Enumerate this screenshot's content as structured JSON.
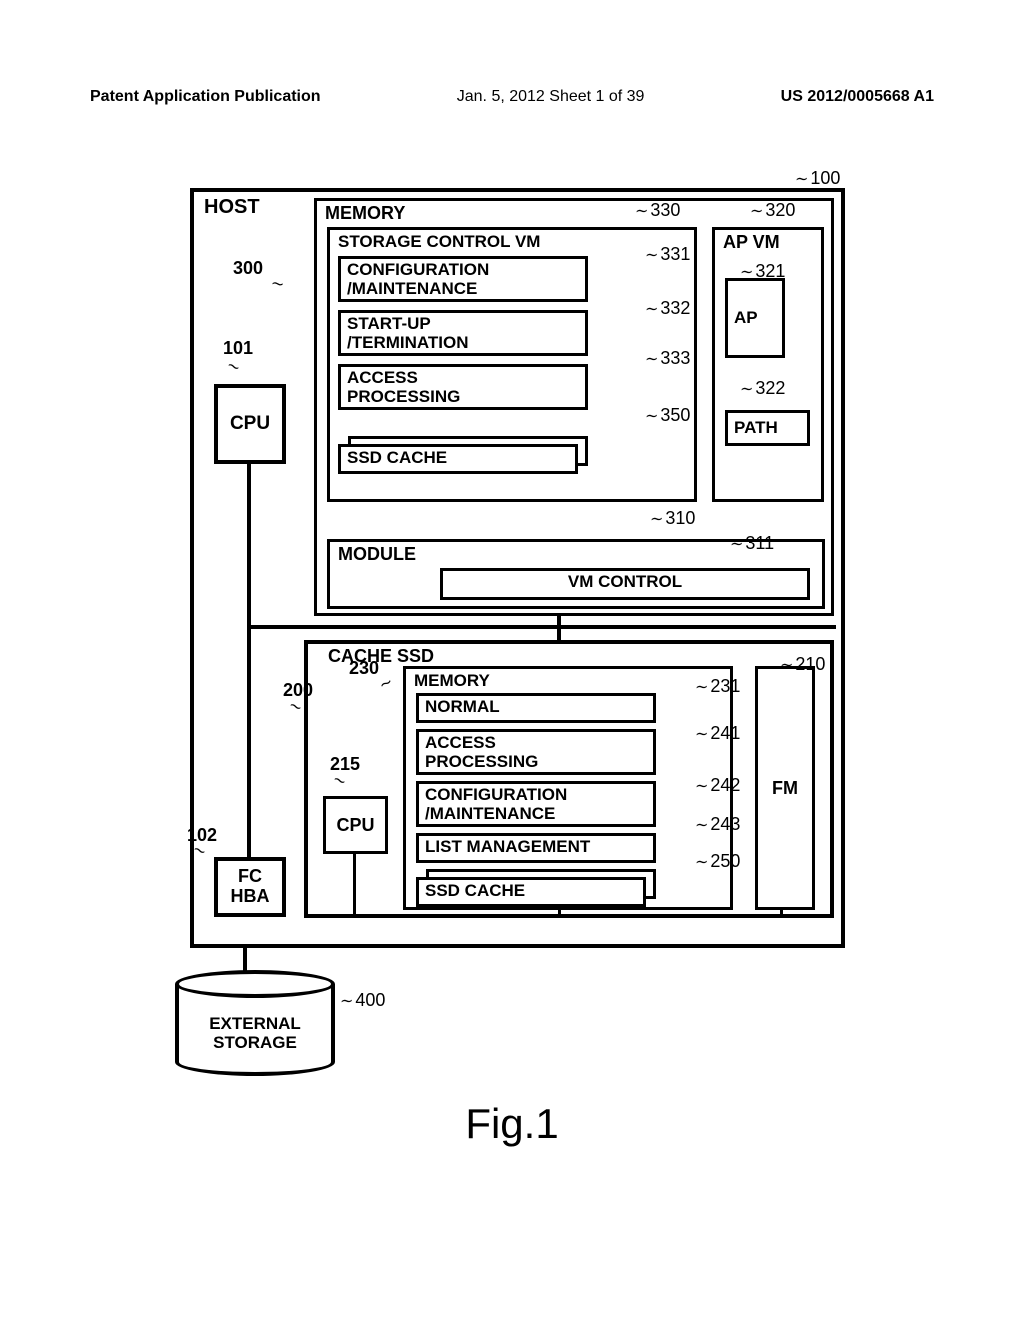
{
  "header": {
    "left": "Patent Application Publication",
    "middle": "Jan. 5, 2012  Sheet 1 of 39",
    "right": "US 2012/0005668 A1"
  },
  "figure_label": "Fig.1",
  "refs": {
    "r100": "100",
    "r101": "101",
    "r102": "102",
    "r200": "200",
    "r210": "210",
    "r215": "215",
    "r230": "230",
    "r231": "231",
    "r241": "241",
    "r242": "242",
    "r243": "243",
    "r250": "250",
    "r300": "300",
    "r310": "310",
    "r311": "311",
    "r320": "320",
    "r321": "321",
    "r322": "322",
    "r330": "330",
    "r331": "331",
    "r332": "332",
    "r333": "333",
    "r350": "350",
    "r400": "400"
  },
  "labels": {
    "host": "HOST",
    "memory": "MEMORY",
    "storage_control_vm": "STORAGE CONTROL VM",
    "config_maint": "CONFIGURATION\n/MAINTENANCE",
    "startup_term": "START-UP\n/TERMINATION",
    "access_proc": "ACCESS\nPROCESSING",
    "ssd_cache": "SSD CACHE",
    "ap_vm": "AP VM",
    "ap": "AP",
    "path": "PATH",
    "module": "MODULE",
    "vm_control": "VM CONTROL",
    "cpu": "CPU",
    "cache_ssd": "CACHE SSD",
    "normal": "NORMAL",
    "list_mgmt": "LIST MANAGEMENT",
    "fm": "FM",
    "fc": "FC",
    "hba": "HBA",
    "external": "EXTERNAL",
    "storage": "STORAGE"
  },
  "chart_data": {
    "type": "diagram",
    "title": "Fig.1",
    "components": [
      {
        "id": 100,
        "name": "HOST",
        "contains": [
          101,
          102,
          300,
          200
        ]
      },
      {
        "id": 101,
        "name": "CPU"
      },
      {
        "id": 102,
        "name": "FC HBA"
      },
      {
        "id": 300,
        "name": "MEMORY",
        "contains": [
          330,
          320,
          310
        ]
      },
      {
        "id": 330,
        "name": "STORAGE CONTROL VM",
        "contains": [
          331,
          332,
          333,
          350
        ]
      },
      {
        "id": 331,
        "name": "CONFIGURATION/MAINTENANCE"
      },
      {
        "id": 332,
        "name": "START-UP/TERMINATION"
      },
      {
        "id": 333,
        "name": "ACCESS PROCESSING"
      },
      {
        "id": 350,
        "name": "SSD CACHE"
      },
      {
        "id": 320,
        "name": "AP VM",
        "contains": [
          321,
          322
        ]
      },
      {
        "id": 321,
        "name": "AP"
      },
      {
        "id": 322,
        "name": "PATH"
      },
      {
        "id": 310,
        "name": "MODULE",
        "contains": [
          311
        ]
      },
      {
        "id": 311,
        "name": "VM CONTROL"
      },
      {
        "id": 200,
        "name": "CACHE SSD",
        "contains": [
          215,
          230,
          210
        ]
      },
      {
        "id": 215,
        "name": "CPU"
      },
      {
        "id": 230,
        "name": "MEMORY",
        "contains": [
          231,
          241,
          242,
          243,
          250
        ]
      },
      {
        "id": 231,
        "name": "NORMAL"
      },
      {
        "id": 241,
        "name": "ACCESS PROCESSING"
      },
      {
        "id": 242,
        "name": "CONFIGURATION/MAINTENANCE"
      },
      {
        "id": 243,
        "name": "LIST MANAGEMENT"
      },
      {
        "id": 250,
        "name": "SSD CACHE"
      },
      {
        "id": 210,
        "name": "FM"
      },
      {
        "id": 400,
        "name": "EXTERNAL STORAGE"
      }
    ],
    "connections": [
      {
        "from": 101,
        "to": "bus"
      },
      {
        "from": 300,
        "to": "bus"
      },
      {
        "from": 200,
        "to": "bus"
      },
      {
        "from": 102,
        "to": "bus"
      },
      {
        "from": 102,
        "to": 400
      },
      {
        "from": 215,
        "to": "ssd-bus"
      },
      {
        "from": 230,
        "to": "ssd-bus"
      },
      {
        "from": 210,
        "to": "ssd-bus"
      }
    ]
  }
}
